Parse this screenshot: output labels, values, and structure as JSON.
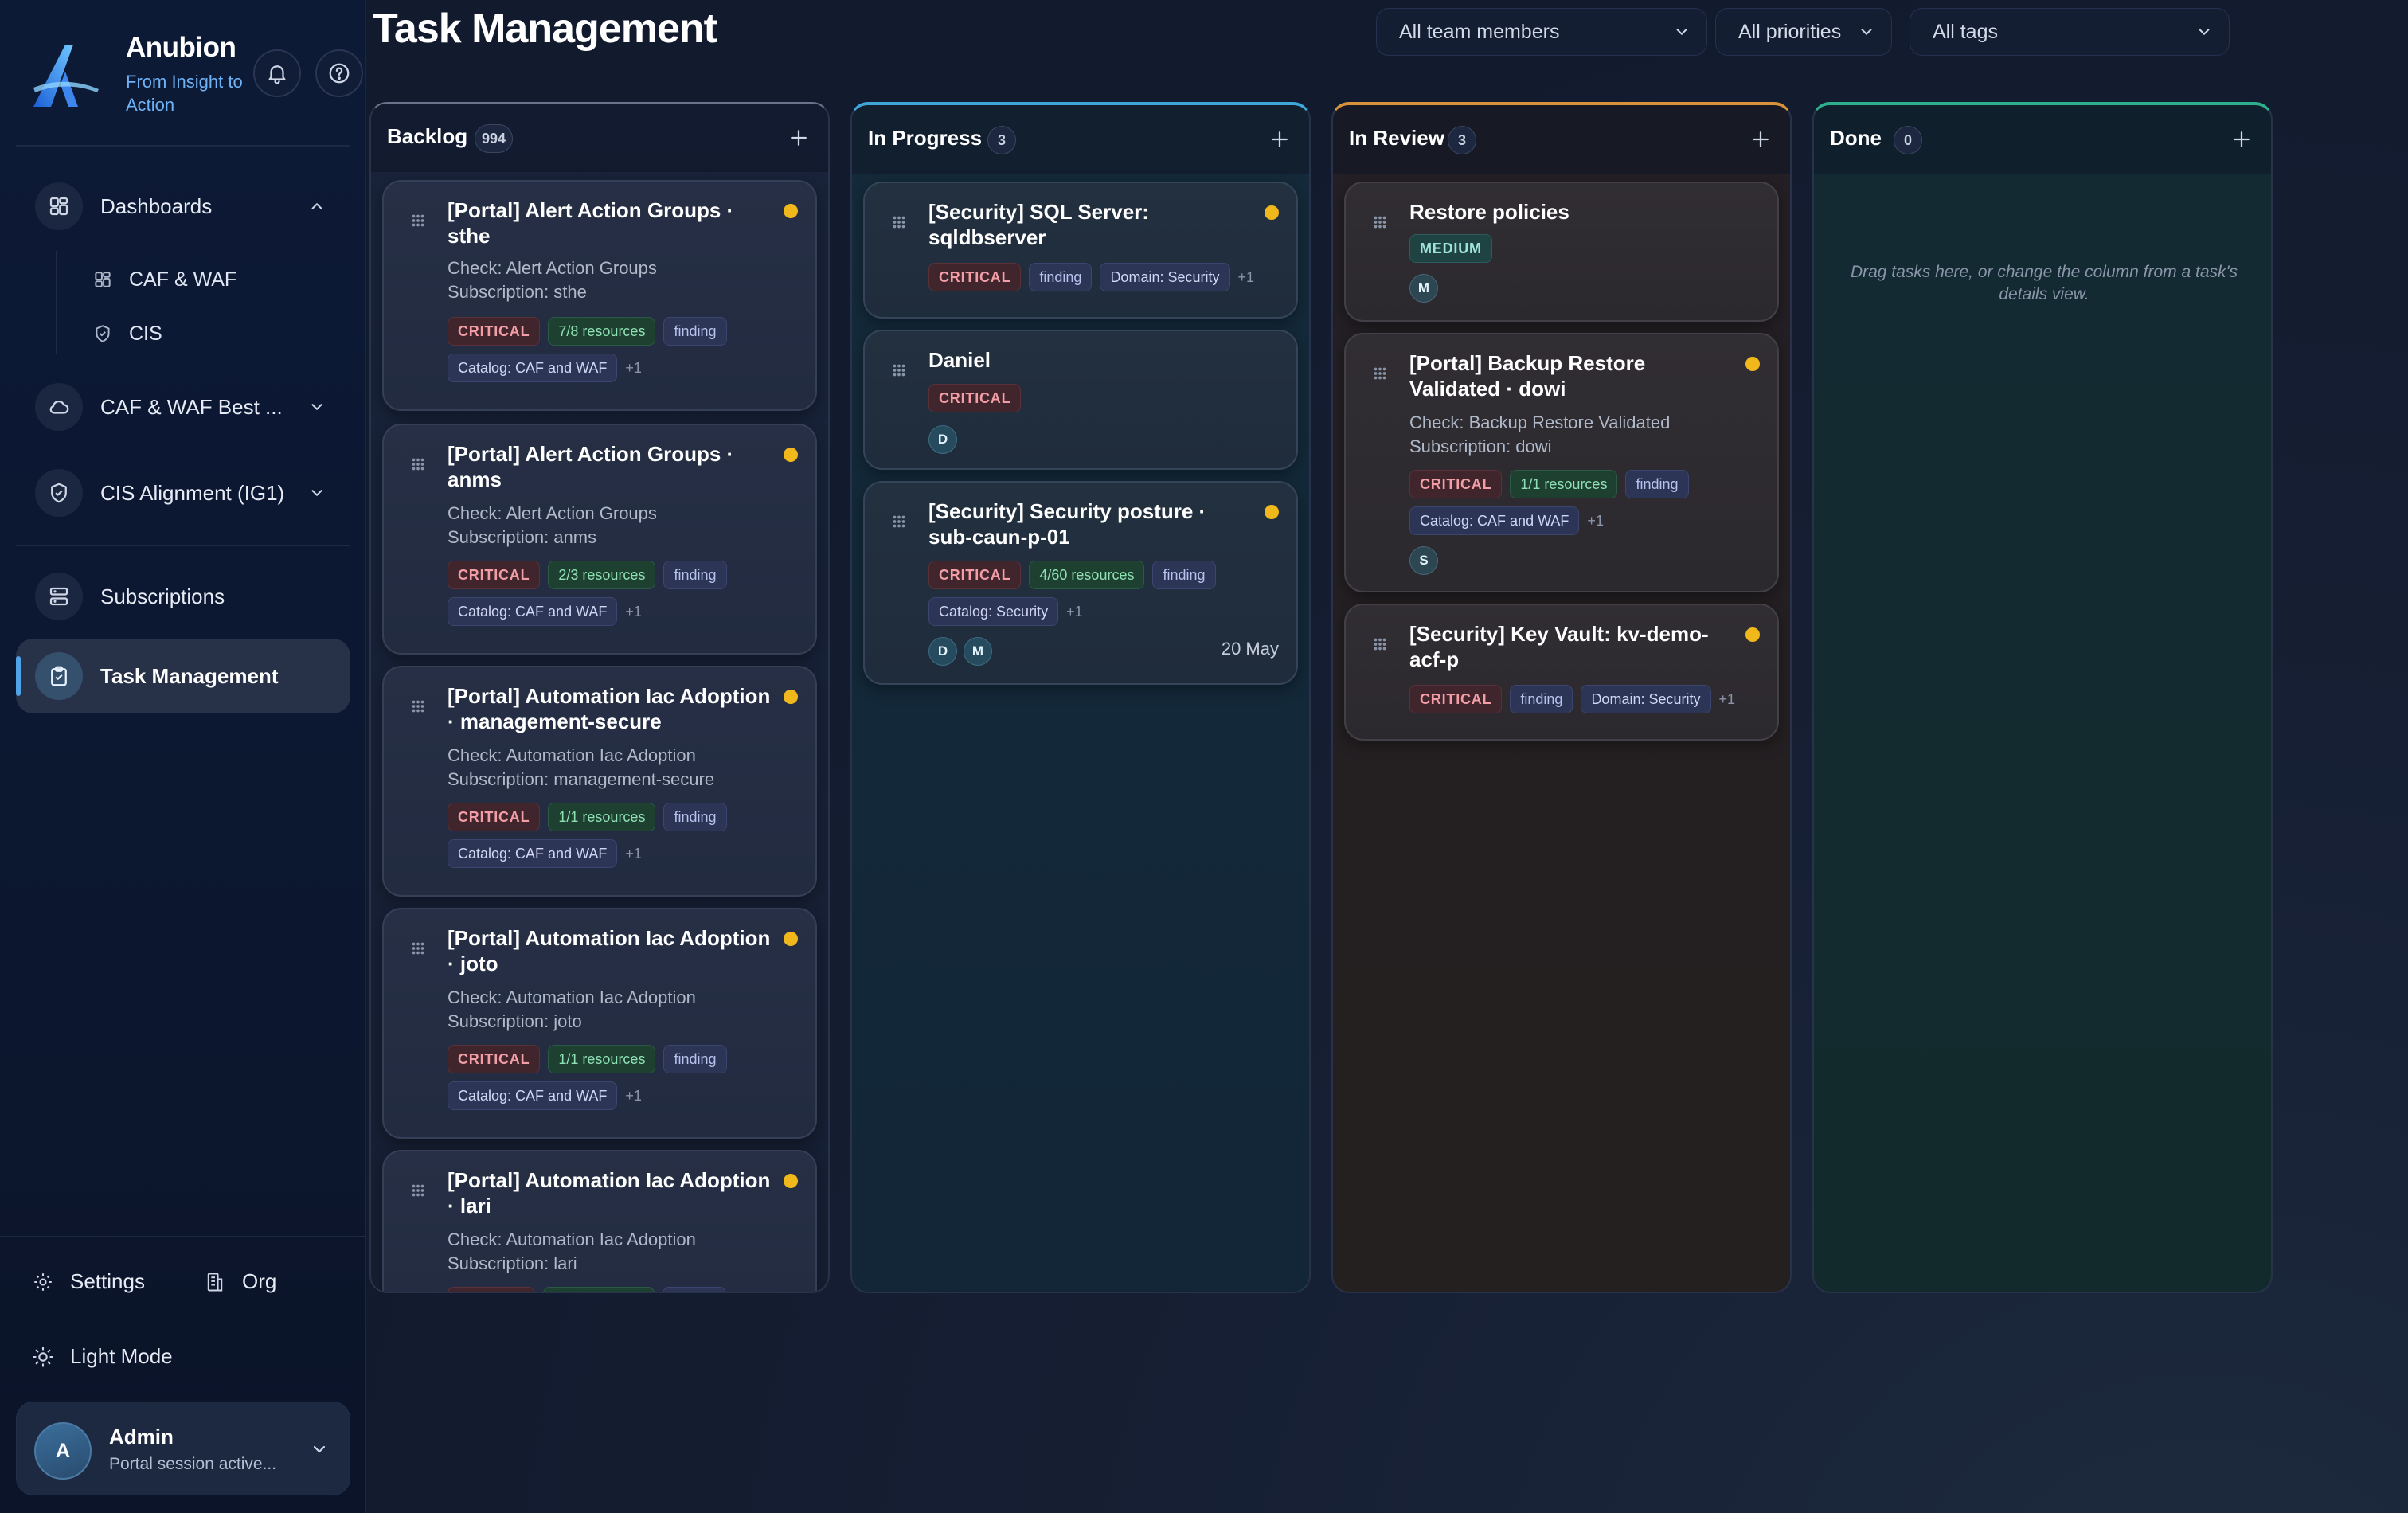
{
  "brand": {
    "name": "Anubion",
    "tagline": "From Insight to Action",
    "accent": "#4fa3e8"
  },
  "header_icons": {
    "notifications": "bell-icon",
    "help": "help-circle-icon"
  },
  "sidebar": {
    "items": [
      {
        "label": "Dashboards",
        "icon": "grid-icon",
        "expanded": true
      },
      {
        "label": "CAF & WAF Best ...",
        "icon": "cloud-icon"
      },
      {
        "label": "CIS Alignment (IG1)",
        "icon": "shield-icon"
      },
      {
        "label": "Subscriptions",
        "icon": "server-icon"
      },
      {
        "label": "Task Management",
        "icon": "clipboard-icon",
        "active": true
      }
    ],
    "subitems": [
      {
        "label": "CAF & WAF",
        "icon": "grid-icon"
      },
      {
        "label": "CIS",
        "icon": "shield-icon"
      }
    ],
    "footer": {
      "settings": "Settings",
      "org": "Org",
      "theme": "Light Mode"
    },
    "user": {
      "initial": "A",
      "name": "Admin",
      "status": "Portal session active..."
    }
  },
  "page": {
    "title": "Task Management"
  },
  "filters": {
    "members": "All team members",
    "priorities": "All priorities",
    "tags": "All tags"
  },
  "columns": [
    {
      "title": "Backlog",
      "count": "994",
      "cards": [
        {
          "title": "[Portal] Alert Action Groups · sthe",
          "check": "Check: Alert Action Groups",
          "subscription": "Subscription: sthe",
          "priority": "CRITICAL",
          "resources": "7/8 resources",
          "type": "finding",
          "catalog": "Catalog: CAF and WAF",
          "more": "+1"
        },
        {
          "title": "[Portal] Alert Action Groups · anms",
          "check": "Check: Alert Action Groups",
          "subscription": "Subscription: anms",
          "priority": "CRITICAL",
          "resources": "2/3 resources",
          "type": "finding",
          "catalog": "Catalog: CAF and WAF",
          "more": "+1"
        },
        {
          "title": "[Portal] Automation Iac Adoption · management-secure",
          "check": "Check: Automation Iac Adoption",
          "subscription": "Subscription: management-secure",
          "priority": "CRITICAL",
          "resources": "1/1 resources",
          "type": "finding",
          "catalog": "Catalog: CAF and WAF",
          "more": "+1"
        },
        {
          "title": "[Portal] Automation Iac Adoption · joto",
          "check": "Check: Automation Iac Adoption",
          "subscription": "Subscription: joto",
          "priority": "CRITICAL",
          "resources": "1/1 resources",
          "type": "finding",
          "catalog": "Catalog: CAF and WAF",
          "more": "+1"
        },
        {
          "title": "[Portal] Automation Iac Adoption · lari",
          "check": "Check: Automation Iac Adoption",
          "subscription": "Subscription: lari"
        }
      ]
    },
    {
      "title": "In Progress",
      "count": "3",
      "cards": [
        {
          "title": "[Security] SQL Server: sqldbserver",
          "priority": "CRITICAL",
          "type": "finding",
          "domain": "Domain: Security",
          "more": "+1"
        },
        {
          "title": "Daniel",
          "priority": "CRITICAL",
          "assignees": [
            "D"
          ]
        },
        {
          "title": "[Security] Security posture · sub-caun-p-01",
          "priority": "CRITICAL",
          "resources": "4/60 resources",
          "type": "finding",
          "catalog": "Catalog: Security",
          "more": "+1",
          "assignees": [
            "D",
            "M"
          ],
          "due": "20 May"
        }
      ]
    },
    {
      "title": "In Review",
      "count": "3",
      "cards": [
        {
          "title": "Restore policies",
          "priority": "MEDIUM",
          "assignees": [
            "M"
          ]
        },
        {
          "title": "[Portal] Backup Restore Validated · dowi",
          "check": "Check: Backup Restore Validated",
          "subscription": "Subscription: dowi",
          "priority": "CRITICAL",
          "resources": "1/1 resources",
          "type": "finding",
          "catalog": "Catalog: CAF and WAF",
          "more": "+1",
          "assignees": [
            "S"
          ]
        },
        {
          "title": "[Security] Key Vault: kv-demo-acf-p",
          "priority": "CRITICAL",
          "type": "finding",
          "domain": "Domain: Security",
          "more": "+1"
        }
      ]
    },
    {
      "title": "Done",
      "count": "0",
      "empty_hint": "Drag tasks here, or change the column from a task's details view."
    }
  ],
  "colors": {
    "priority_dot": "#f0b81b",
    "in_progress": "#3fa6d7",
    "in_review": "#d89239",
    "done": "#2fae8e"
  }
}
